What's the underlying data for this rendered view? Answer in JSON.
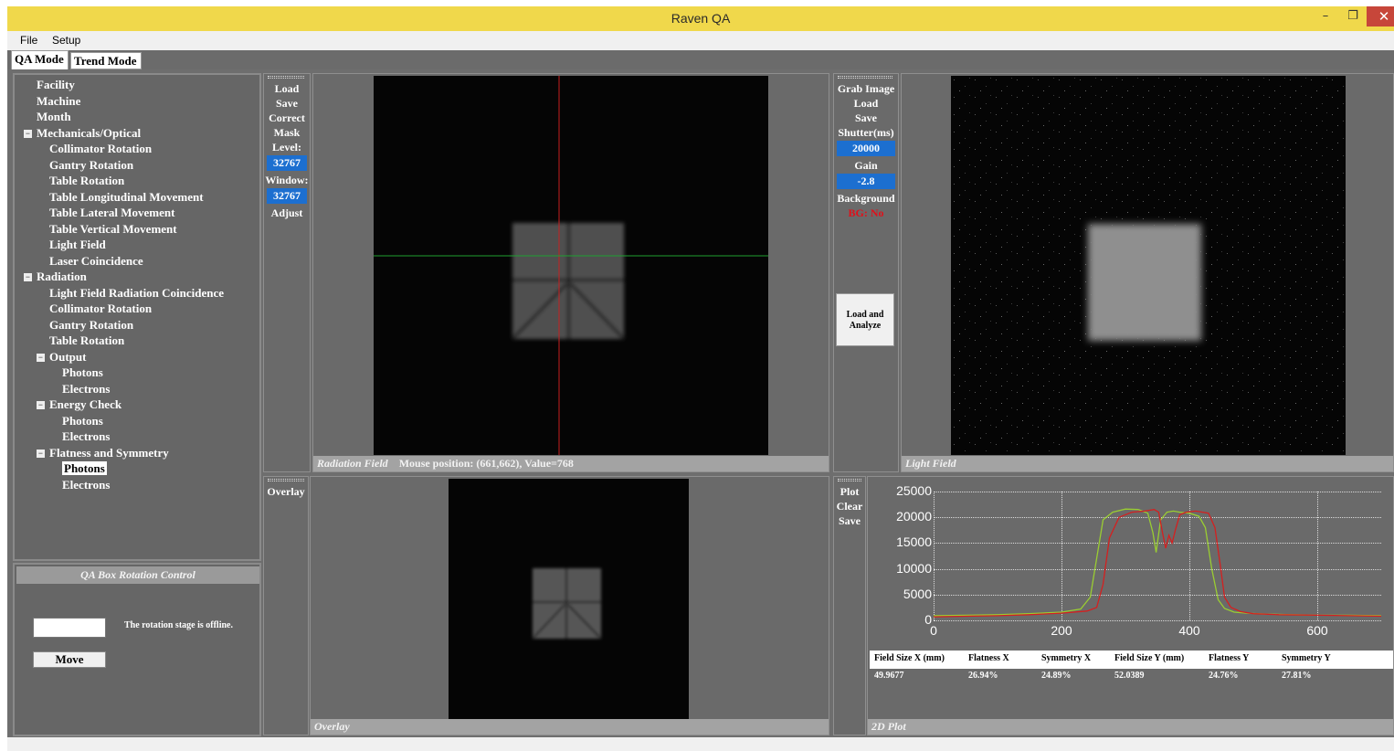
{
  "window": {
    "title": "Raven QA",
    "minimize": "–",
    "maximize": "❐",
    "close": "✕"
  },
  "menu": {
    "file": "File",
    "setup": "Setup"
  },
  "tabs": [
    {
      "label": "QA Mode",
      "active": true
    },
    {
      "label": "Trend Mode",
      "active": false
    }
  ],
  "tree": {
    "items": [
      {
        "label": "Facility"
      },
      {
        "label": "Machine"
      },
      {
        "label": "Month"
      },
      {
        "label": "Mechanicals/Optical",
        "expander": "−"
      },
      {
        "label": "Collimator Rotation"
      },
      {
        "label": "Gantry Rotation"
      },
      {
        "label": "Table Rotation"
      },
      {
        "label": "Table Longitudinal Movement"
      },
      {
        "label": "Table Lateral Movement"
      },
      {
        "label": "Table Vertical Movement"
      },
      {
        "label": "Light Field"
      },
      {
        "label": "Laser Coincidence"
      },
      {
        "label": "Radiation",
        "expander": "−"
      },
      {
        "label": "Light Field Radiation Coincidence"
      },
      {
        "label": "Collimator Rotation"
      },
      {
        "label": "Gantry Rotation"
      },
      {
        "label": "Table Rotation"
      },
      {
        "label": "Output",
        "expander": "−"
      },
      {
        "label": "Photons"
      },
      {
        "label": "Electrons"
      },
      {
        "label": "Energy Check",
        "expander": "−"
      },
      {
        "label": "Photons"
      },
      {
        "label": "Electrons"
      },
      {
        "label": "Flatness and Symmetry",
        "expander": "−"
      },
      {
        "label": "Photons",
        "selected": true
      },
      {
        "label": "Electrons"
      }
    ]
  },
  "qa_box": {
    "header": "QA Box Rotation Control",
    "angle_value": "",
    "status": "The rotation stage is offline.",
    "move_label": "Move"
  },
  "radiation_toolbar": {
    "load": "Load",
    "save": "Save",
    "correct": "Correct",
    "mask": "Mask",
    "level_label": "Level:",
    "level_value": "32767",
    "window_label": "Window:",
    "window_value": "32767",
    "adjust": "Adjust"
  },
  "radiation_view": {
    "caption": "Radiation Field",
    "mouse": "Mouse position: (661,662), Value=768"
  },
  "light_toolbar": {
    "grab": "Grab Image",
    "load": "Load",
    "save": "Save",
    "shutter_label": "Shutter(ms)",
    "shutter_value": "20000",
    "gain_label": "Gain",
    "gain_value": "-2.8",
    "background_label": "Background",
    "bg_status": "BG: No",
    "analyze": "Load and Analyze"
  },
  "light_view": {
    "caption": "Light Field"
  },
  "overlay_toolbar": {
    "overlay": "Overlay"
  },
  "overlay_view": {
    "caption": "Overlay"
  },
  "plot_toolbar": {
    "plot": "Plot",
    "clear": "Clear",
    "save": "Save"
  },
  "plot_view": {
    "caption": "2D Plot"
  },
  "chart_data": {
    "type": "line",
    "xlim": [
      0,
      700
    ],
    "ylim": [
      0,
      25000
    ],
    "xticks": [
      0,
      200,
      400,
      600
    ],
    "yticks": [
      0,
      5000,
      10000,
      15000,
      20000,
      25000
    ],
    "grid": true,
    "series": [
      {
        "color": "#9acd32",
        "x": [
          0,
          50,
          100,
          150,
          200,
          230,
          245,
          255,
          265,
          280,
          300,
          320,
          335,
          343,
          348,
          355,
          365,
          375,
          385,
          400,
          415,
          425,
          435,
          445,
          455,
          470,
          490,
          520,
          560,
          600,
          650,
          700
        ],
        "y": [
          900,
          1000,
          1100,
          1300,
          1600,
          2200,
          4500,
          12000,
          19500,
          21000,
          21600,
          21500,
          20800,
          17000,
          13200,
          19500,
          21000,
          21200,
          21000,
          20800,
          20200,
          18000,
          10000,
          4000,
          2300,
          1600,
          1400,
          1200,
          1100,
          1000,
          1000,
          900
        ]
      },
      {
        "color": "#d42020",
        "x": [
          0,
          50,
          100,
          150,
          200,
          240,
          255,
          265,
          275,
          290,
          310,
          330,
          345,
          352,
          358,
          363,
          368,
          373,
          378,
          385,
          395,
          410,
          430,
          440,
          448,
          455,
          465,
          480,
          500,
          540,
          600,
          650,
          700
        ],
        "y": [
          700,
          800,
          900,
          1100,
          1400,
          1800,
          2500,
          7000,
          16000,
          20000,
          21000,
          21200,
          21500,
          21000,
          17000,
          14000,
          16500,
          15000,
          17500,
          20500,
          21000,
          21200,
          20800,
          18000,
          11000,
          4500,
          2500,
          1700,
          1300,
          1100,
          1000,
          900,
          800
        ]
      }
    ]
  },
  "results": {
    "headers": [
      "Field Size X (mm)",
      "Flatness X",
      "Symmetry X",
      "Field Size Y (mm)",
      "Flatness Y",
      "Symmetry Y"
    ],
    "values": [
      "49.9677",
      "26.94%",
      "24.89%",
      "52.0389",
      "24.76%",
      "27.81%"
    ]
  }
}
